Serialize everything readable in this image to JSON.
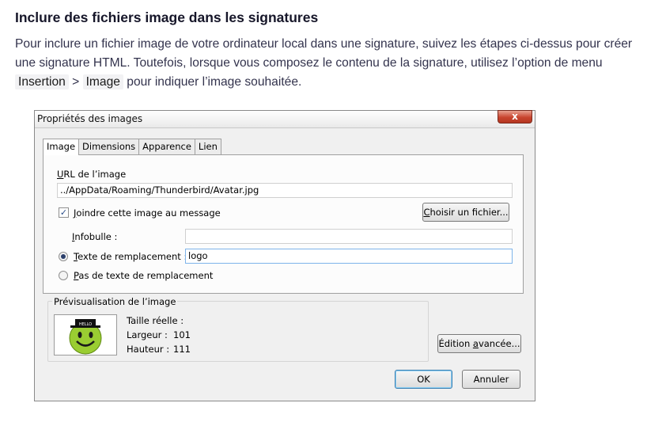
{
  "article": {
    "title": "Inclure des fichiers image dans les signatures",
    "para_before": "Pour inclure un fichier image de votre ordinateur local dans une signature, suivez les étapes ci-dessus pour créer une signature HTML. Toutefois, lorsque vous composez le contenu de la signature, utilisez l’option de menu ",
    "menu_1": "Insertion",
    "separator": " > ",
    "menu_2": "Image",
    "para_after": " pour indiquer l’image souhaitée."
  },
  "dialog": {
    "title": "Propriétés des images",
    "close_label": "x",
    "tabs": [
      {
        "label": "Image",
        "active": true
      },
      {
        "label": "Dimensions",
        "active": false
      },
      {
        "label": "Apparence",
        "active": false
      },
      {
        "label": "Lien",
        "active": false
      }
    ],
    "url_label_prefix": "U",
    "url_label_rest": "RL de l’image",
    "url_value": "../AppData/Roaming/Thunderbird/Avatar.jpg",
    "attach_checked": true,
    "attach_label_prefix": "J",
    "attach_label_rest": "oindre cette image au message",
    "choose_file_prefix": "C",
    "choose_file_rest": "hoisir un fichier...",
    "tooltip_label_prefix": "I",
    "tooltip_label_rest": "nfobulle :",
    "tooltip_value": "",
    "alt_label_prefix": "T",
    "alt_label_rest": "exte de remplacement :",
    "alt_value": "logo",
    "noalt_label_prefix": "P",
    "noalt_label_rest": "as de texte de remplacement",
    "preview": {
      "group_label": "Prévisualisation de l’image",
      "hat_text": "HELLO",
      "real_size_label": "Taille réelle :",
      "width_label": "Largeur :",
      "width_value": "101",
      "height_label": "Hauteur :",
      "height_value": "111"
    },
    "advanced_prefix": "Édition ",
    "advanced_underlined": "a",
    "advanced_rest": "vancée...",
    "ok_label": "OK",
    "cancel_label": "Annuler"
  },
  "colors": {
    "title": "#161629",
    "body_text": "#33334d",
    "code_bg": "#f2f2f4",
    "dialog_bg": "#f0f0f0",
    "smiley": "#9acd32"
  }
}
